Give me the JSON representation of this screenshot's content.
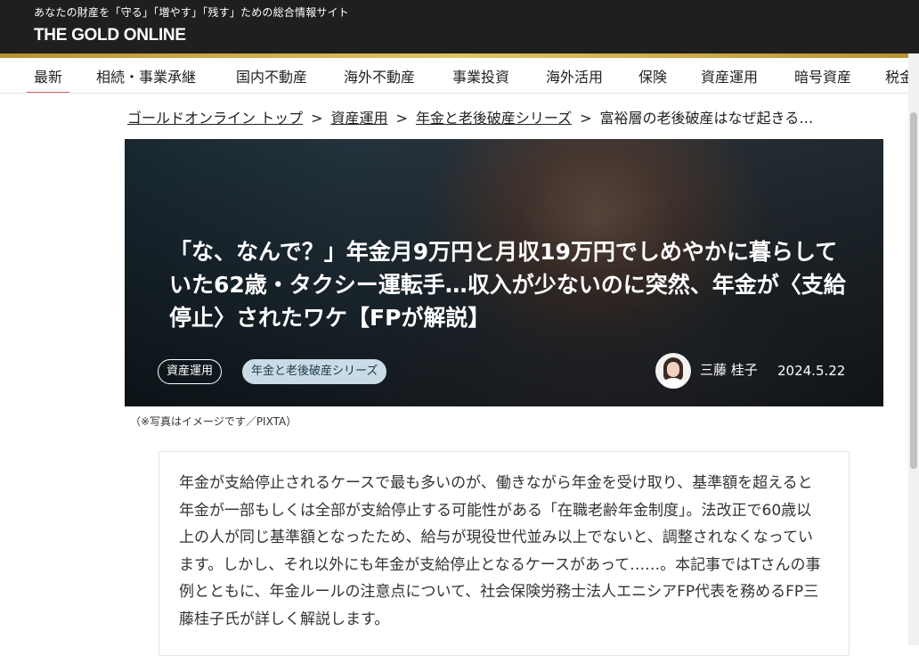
{
  "header": {
    "tagline": "あなたの財産を「守る」「増やす」「残す」ための総合情報サイト",
    "logo": "THE GOLD ONLINE"
  },
  "nav": {
    "items": [
      "最新",
      "相続・事業承継",
      "国内不動産",
      "海外不動産",
      "事業投資",
      "海外活用",
      "保険",
      "資産運用",
      "暗号資産",
      "税金"
    ],
    "active_index": 0
  },
  "breadcrumb": {
    "items": [
      "ゴールドオンライン トップ",
      "資産運用",
      "年金と老後破産シリーズ",
      "富裕層の老後破産はなぜ起きる…"
    ],
    "separator": ">"
  },
  "article": {
    "title": "「な、なんで？」年金月9万円と月収19万円でしめやかに暮らしていた62歳・タクシー運転手…収入が少ないのに突然、年金が〈支給停止〉されたワケ【FPが解説】",
    "tags": [
      "資産運用",
      "年金と老後破産シリーズ"
    ],
    "author": "三藤 桂子",
    "date": "2024.5.22",
    "photo_caption": "（※写真はイメージです／PIXTA）",
    "lead": "年金が支給停止されるケースで最も多いのが、働きながら年金を受け取り、基準額を超えると年金が一部もしくは全部が支給停止する可能性がある「在職老齢年金制度」。法改正で60歳以上の人が同じ基準額となったため、給与が現役世代並み以上でないと、調整されなくなっています。しかし、それ以外にも年金が支給停止となるケースがあって……。本記事ではTさんの事例とともに、年金ルールの注意点について、社会保険労務士法人エニシアFP代表を務めるFP三藤桂子氏が詳しく解説します。"
  },
  "colors": {
    "header_bg": "#1f1f1f",
    "gold_accent": "#d4b24c",
    "nav_active": "#e35b6a",
    "tag_fill": "#c9dbe5"
  }
}
